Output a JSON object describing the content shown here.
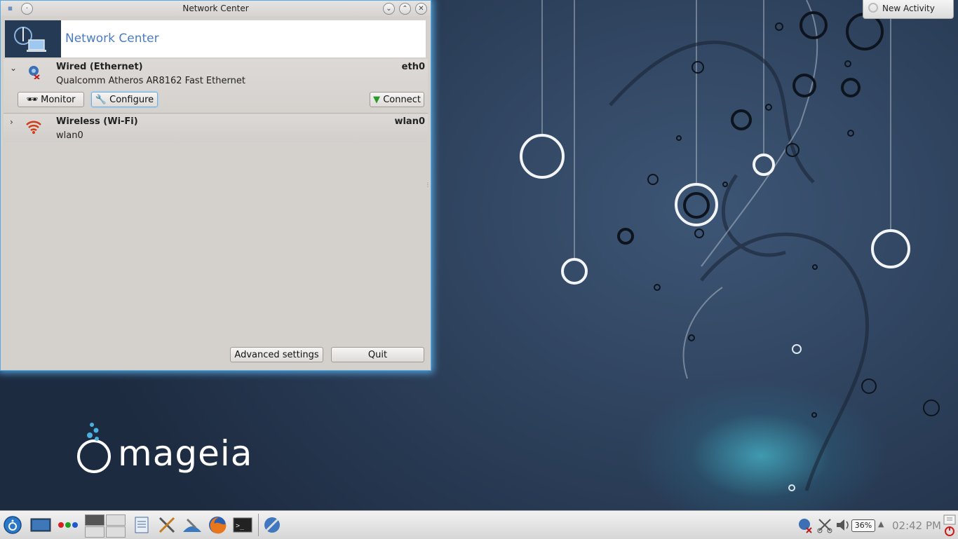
{
  "window": {
    "title": "Network Center",
    "header_title": "Network Center"
  },
  "interfaces": [
    {
      "name": "Wired (Ethernet)",
      "device": "eth0",
      "description": "Qualcomm Atheros AR8162 Fast Ethernet",
      "expanded": true,
      "buttons": {
        "monitor": "Monitor",
        "configure": "Configure",
        "connect": "Connect"
      }
    },
    {
      "name": "Wireless (Wi-Fi)",
      "device": "wlan0",
      "description": "wlan0",
      "expanded": false
    }
  ],
  "footer": {
    "advanced": "Advanced settings",
    "quit": "Quit"
  },
  "desktop": {
    "new_activity": "New Activity",
    "logo_text": "mageia"
  },
  "tray": {
    "battery": "36%",
    "clock": "02:42 PM"
  },
  "colors": {
    "header_title": "#4a7cc0",
    "window_glow": "#5aa8e0",
    "desktop_bg": "#2b3e58"
  },
  "icons": {
    "taskbar": [
      "mageia-menu-icon",
      "desktop-icon",
      "activities-dots-icon",
      "pager-icon",
      "notes-icon",
      "tools-icon",
      "network-tools-icon",
      "firefox-icon",
      "terminal-icon",
      "network-center-icon"
    ],
    "tray": [
      "network-status-icon",
      "clipboard-icon",
      "volume-icon",
      "battery-icon",
      "tray-expand-icon",
      "shutdown-icon"
    ]
  }
}
